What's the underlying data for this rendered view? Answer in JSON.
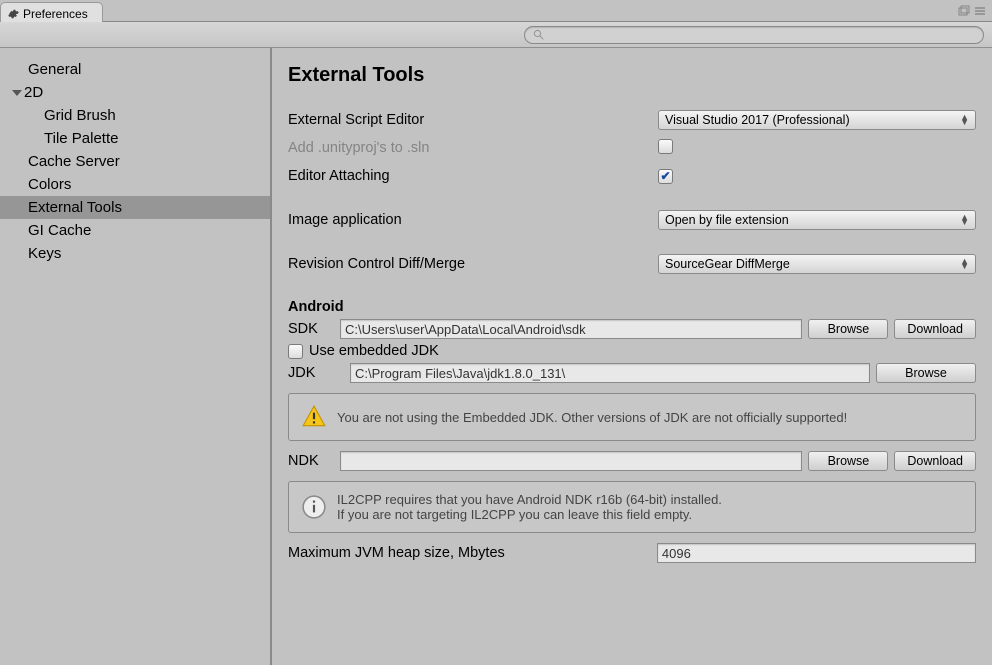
{
  "window": {
    "title": "Preferences"
  },
  "sidebar": {
    "items": [
      {
        "label": "General",
        "child": false
      },
      {
        "label": "2D",
        "child": false,
        "expanded": true
      },
      {
        "label": "Grid Brush",
        "child": true
      },
      {
        "label": "Tile Palette",
        "child": true
      },
      {
        "label": "Cache Server",
        "child": false
      },
      {
        "label": "Colors",
        "child": false
      },
      {
        "label": "External Tools",
        "child": false,
        "selected": true
      },
      {
        "label": "GI Cache",
        "child": false
      },
      {
        "label": "Keys",
        "child": false
      }
    ]
  },
  "main": {
    "heading": "External Tools",
    "rows": {
      "script_editor_label": "External Script Editor",
      "script_editor_value": "Visual Studio 2017 (Professional)",
      "unityproj_label": "Add .unityproj's to .sln",
      "editor_attaching_label": "Editor Attaching",
      "image_app_label": "Image application",
      "image_app_value": "Open by file extension",
      "rev_ctrl_label": "Revision Control Diff/Merge",
      "rev_ctrl_value": "SourceGear DiffMerge"
    },
    "android": {
      "heading": "Android",
      "sdk_label": "SDK",
      "sdk_value": "C:\\Users\\user\\AppData\\Local\\Android\\sdk",
      "embedded_label": "Use embedded JDK",
      "jdk_label": "JDK",
      "jdk_value": "C:\\Program Files\\Java\\jdk1.8.0_131\\",
      "warn_text": "You are not using the Embedded JDK. Other versions of JDK are not officially supported!",
      "ndk_label": "NDK",
      "ndk_value": "",
      "info_line1": "IL2CPP requires that you have Android NDK r16b (64-bit) installed.",
      "info_line2": "If you are not targeting IL2CPP you can leave this field empty.",
      "heap_label": "Maximum JVM heap size, Mbytes",
      "heap_value": "4096"
    },
    "buttons": {
      "browse": "Browse",
      "download": "Download"
    }
  }
}
